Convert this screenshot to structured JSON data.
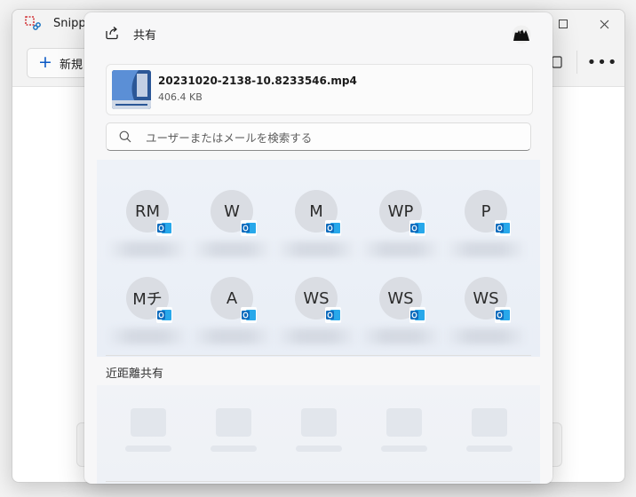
{
  "app": {
    "title": "Snippi",
    "toolbar": {
      "new_label": "新規"
    },
    "window_controls": [
      "minimize",
      "maximize",
      "close"
    ]
  },
  "share": {
    "title": "共有",
    "file": {
      "name": "20231020-2138-10.8233546.mp4",
      "size": "406.4 KB"
    },
    "search": {
      "placeholder": "ユーザーまたはメールを検索する"
    },
    "contacts": [
      {
        "initials": "RM"
      },
      {
        "initials": "W"
      },
      {
        "initials": "M"
      },
      {
        "initials": "WP"
      },
      {
        "initials": "P"
      },
      {
        "initials": "Mチ"
      },
      {
        "initials": "A"
      },
      {
        "initials": "WS"
      },
      {
        "initials": "WS"
      },
      {
        "initials": "WS"
      }
    ],
    "nearby_title": "近距離共有"
  },
  "icons": {
    "share": "share-arrow-icon",
    "search": "search-icon",
    "outlook": "outlook-badge-icon",
    "account": "account-avatar-icon"
  },
  "colors": {
    "accent": "#0a58c4",
    "outlook_blue": "#0f6cbd",
    "avatar_bg": "#dadde3"
  }
}
